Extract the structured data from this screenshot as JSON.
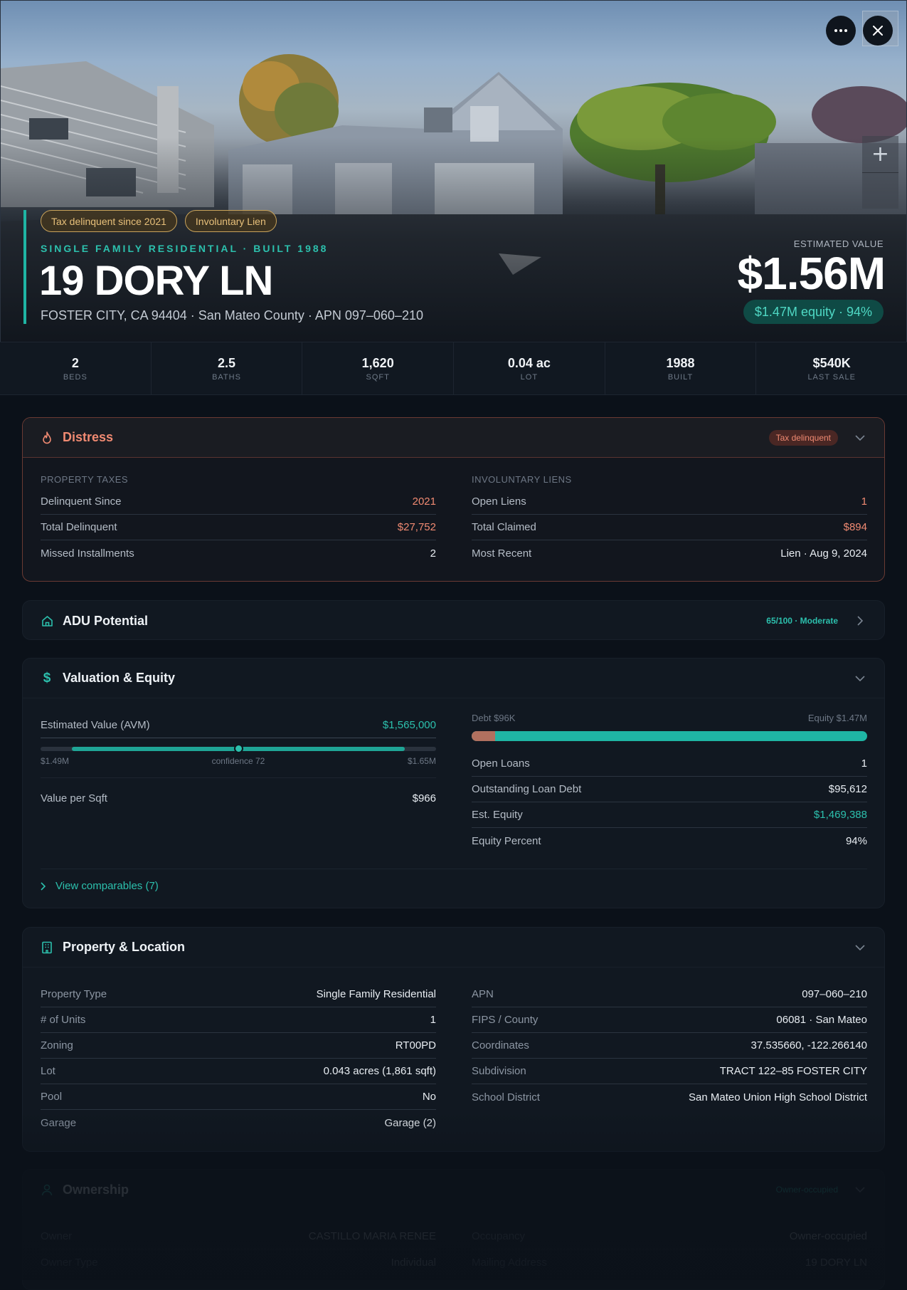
{
  "hero": {
    "chips": [
      "Tax delinquent since 2021",
      "Involuntary Lien"
    ],
    "subtype": "SINGLE FAMILY RESIDENTIAL · BUILT 1988",
    "address": "19 DORY LN",
    "location": "FOSTER CITY, CA 94404 · San Mateo County · APN 097–060–210",
    "estimated_label": "ESTIMATED VALUE",
    "estimated_value": "$1.56M",
    "equity_pill": "$1.47M equity · 94%"
  },
  "stats": [
    {
      "value": "2",
      "label": "BEDS"
    },
    {
      "value": "2.5",
      "label": "BATHS"
    },
    {
      "value": "1,620",
      "label": "SQFT"
    },
    {
      "value": "0.04 ac",
      "label": "LOT"
    },
    {
      "value": "1988",
      "label": "BUILT"
    },
    {
      "value": "$540K",
      "label": "LAST SALE"
    }
  ],
  "distress": {
    "title": "Distress",
    "badge": "Tax delinquent",
    "taxes": {
      "label": "PROPERTY TAXES",
      "rows": [
        {
          "k": "Delinquent Since",
          "v": "2021"
        },
        {
          "k": "Total Delinquent",
          "v": "$27,752"
        },
        {
          "k": "Missed Installments",
          "v": "2"
        }
      ]
    },
    "liens": {
      "label": "INVOLUNTARY LIENS",
      "rows": [
        {
          "k": "Open Liens",
          "v": "1"
        },
        {
          "k": "Total Claimed",
          "v": "$894"
        },
        {
          "k": "Most Recent",
          "v": "Lien · Aug 9, 2024"
        }
      ]
    }
  },
  "adu": {
    "title": "ADU Potential",
    "score": "65/100 · Moderate"
  },
  "valuation": {
    "title": "Valuation & Equity",
    "avm_label": "Estimated Value (AVM)",
    "avm_value": "$1,565,000",
    "avm_low": "$1.49M",
    "avm_confidence": "confidence 72",
    "avm_high": "$1.65M",
    "avm_position": 0.5,
    "avm_range_start": 0.08,
    "avm_range_end": 0.92,
    "per_sqft_label": "Value per Sqft",
    "per_sqft_value": "$966",
    "debt_label": "Debt $96K",
    "equity_label": "Equity $1.47M",
    "debt_fraction": 0.06,
    "rows": [
      {
        "k": "Open Loans",
        "v": "1"
      },
      {
        "k": "Outstanding Loan Debt",
        "v": "$95,612"
      },
      {
        "k": "Est. Equity",
        "v": "$1,469,388"
      },
      {
        "k": "Equity Percent",
        "v": "94%"
      }
    ],
    "comps_link": "View comparables (7)"
  },
  "property": {
    "title": "Property & Location",
    "left": [
      {
        "k": "Property Type",
        "v": "Single Family Residential"
      },
      {
        "k": "# of Units",
        "v": "1"
      },
      {
        "k": "Zoning",
        "v": "RT00PD"
      },
      {
        "k": "Lot",
        "v": "0.043 acres (1,861 sqft)"
      },
      {
        "k": "Pool",
        "v": "No"
      },
      {
        "k": "Garage",
        "v": "Garage (2)"
      }
    ],
    "right": [
      {
        "k": "APN",
        "v": "097–060–210"
      },
      {
        "k": "FIPS / County",
        "v": "06081 · San Mateo"
      },
      {
        "k": "Coordinates",
        "v": "37.535660, -122.266140"
      },
      {
        "k": "Subdivision",
        "v": "TRACT 122–85 FOSTER CITY"
      },
      {
        "k": "School District",
        "v": "San Mateo Union High School District"
      }
    ]
  },
  "ownership": {
    "title": "Ownership",
    "badge": "Owner-occupied",
    "left": [
      {
        "k": "Owner",
        "v": "CASTILLO MARIA RENEE"
      },
      {
        "k": "Owner Type",
        "v": "Individual"
      }
    ],
    "right": [
      {
        "k": "Occupancy",
        "v": "Owner-occupied"
      },
      {
        "k": "Mailing Address",
        "v": "19 DORY LN"
      }
    ]
  },
  "colors": {
    "accent": "#1fb5a4",
    "distress": "#f08a72",
    "warning": "#e7c07a"
  },
  "icons": [
    "more-icon",
    "close-icon",
    "zoom-in-icon",
    "flame-icon",
    "home-icon",
    "dollar-icon",
    "building-icon",
    "user-icon",
    "chevron-down-icon",
    "chevron-right-icon"
  ]
}
